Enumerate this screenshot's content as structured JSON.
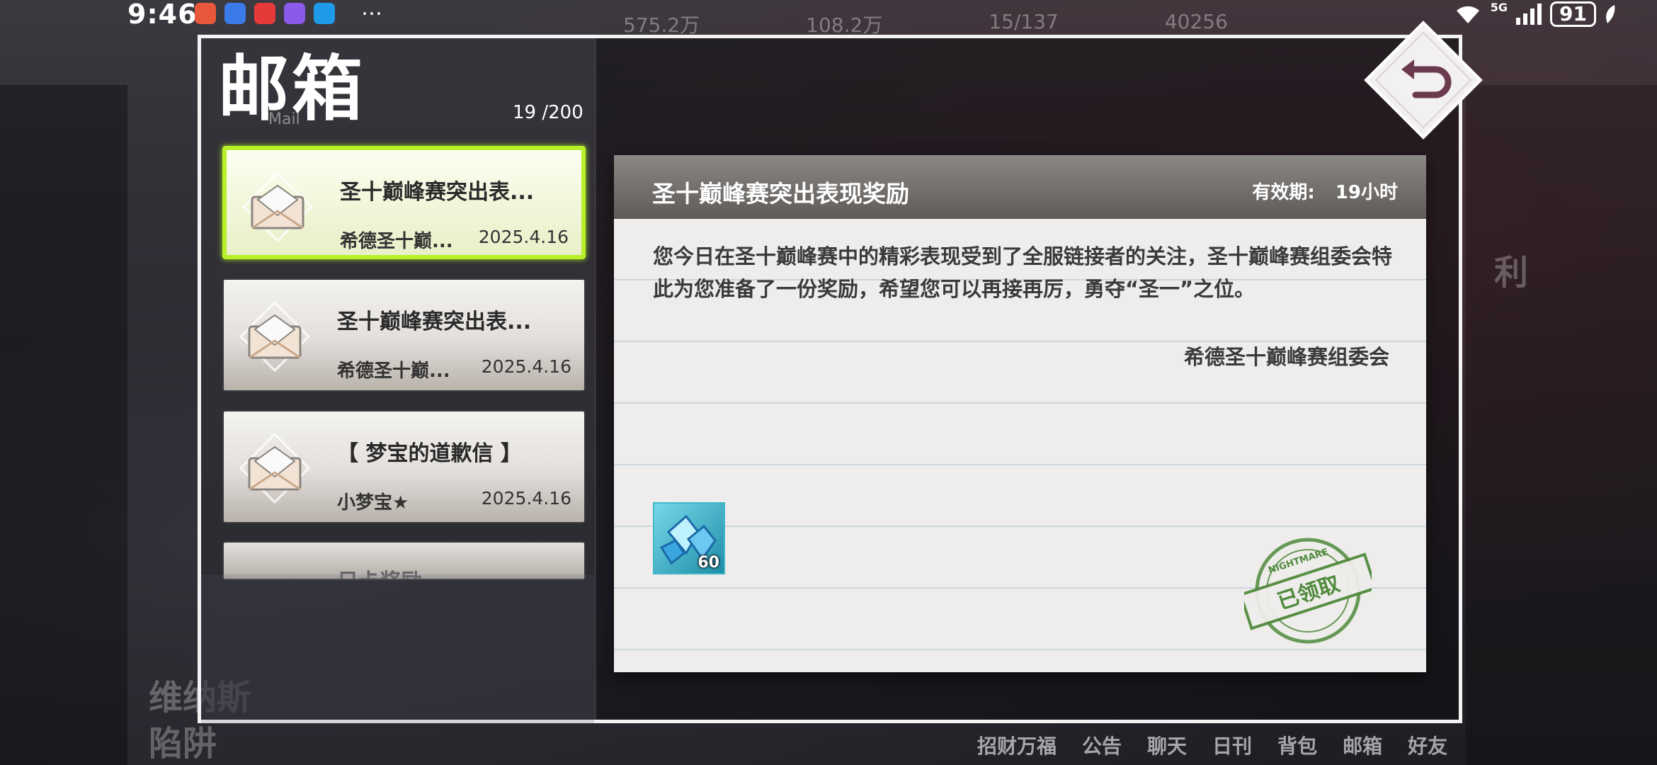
{
  "status_bar": {
    "time": "9:46",
    "network": "5G",
    "battery": "91"
  },
  "background": {
    "resources": [
      "575.2万",
      "108.2万",
      "15/137",
      "40256"
    ],
    "side_labels": [
      "利"
    ],
    "bottom_left_title": "维纳斯",
    "bottom_left_title2": "陷阱",
    "nav": [
      "招财万福",
      "公告",
      "聊天",
      "日刊",
      "背包",
      "邮箱",
      "好友"
    ]
  },
  "mailbox": {
    "title": "邮箱",
    "subtitle": "Mail",
    "count": "19 /200",
    "items": [
      {
        "title": "圣十巅峰赛突出表...",
        "sender": "希德圣十巅...",
        "date": "2025.4.16",
        "selected": true
      },
      {
        "title": "圣十巅峰赛突出表...",
        "sender": "希德圣十巅...",
        "date": "2025.4.16",
        "selected": false
      },
      {
        "title": "【 梦宝的道歉信 】",
        "sender": "小梦宝★",
        "date": "2025.4.16",
        "selected": false
      },
      {
        "title": "日卡奖励",
        "sender": "",
        "date": "",
        "selected": false
      }
    ]
  },
  "detail": {
    "title": "圣十巅峰赛突出表现奖励",
    "validity_label": "有效期:",
    "validity_value": "19小时",
    "body": "您今日在圣十巅峰赛中的精彩表现受到了全服链接者的关注，圣十巅峰赛组委会特此为您准备了一份奖励，希望您可以再接再厉，勇夺“圣一”之位。",
    "signature": "希德圣十巅峰赛组委会",
    "attachment": {
      "icon": "blue-crystal-icon",
      "quantity": "60"
    },
    "stamp": {
      "text": "已领取",
      "ring_text": "NIGHTMARE"
    }
  },
  "colors": {
    "selected_border": "#b8f02a",
    "stamp_green": "#4f8a3c",
    "panel_border": "#f3f3f3"
  }
}
